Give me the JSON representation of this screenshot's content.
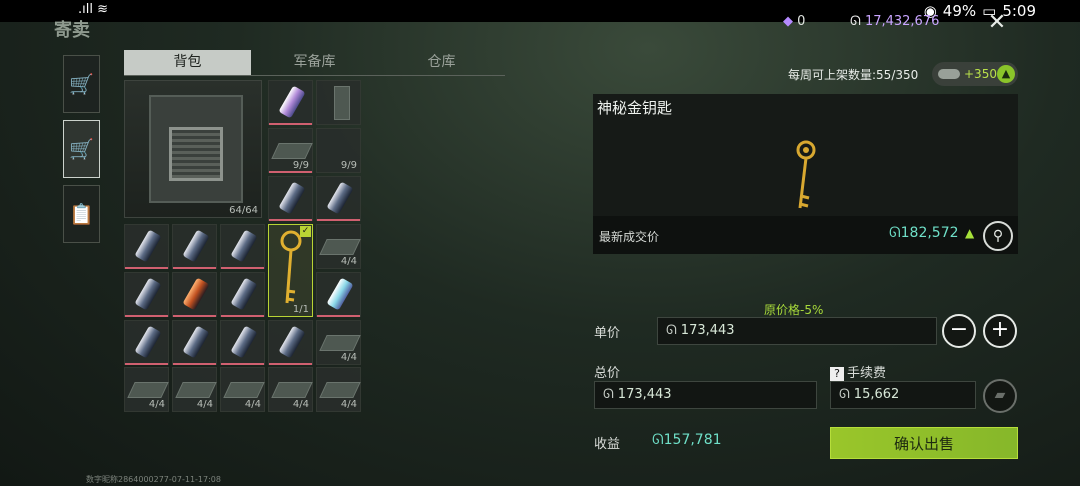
{
  "status_bar": {
    "battery": "49%",
    "time": "5:09"
  },
  "header": {
    "title": "寄卖",
    "diamonds": "0",
    "coins": "17,432,676",
    "close_icon": "close-icon"
  },
  "sidebar": [
    {
      "name": "shop-tab",
      "icon": "shopping-cart-icon"
    },
    {
      "name": "sell-tab",
      "icon": "sell-cart-icon",
      "active": true
    },
    {
      "name": "records-tab",
      "icon": "clipboard-icon"
    }
  ],
  "inventory": {
    "tabs": [
      {
        "label": "背包",
        "active": true
      },
      {
        "label": "军备库",
        "active": false
      },
      {
        "label": "仓库",
        "active": false
      }
    ],
    "big_item_qty": "64/64",
    "selected_key_qty": "1/1",
    "plate_qty": "9/9",
    "stack_qty": "4/4"
  },
  "sell_panel": {
    "weekly_label": "每周可上架数量:55/350",
    "weekly_badge": "+350",
    "item_name": "神秘金钥匙",
    "latest_label": "最新成交价",
    "latest_price": "182,572",
    "discount_text": "原价格-5%",
    "unit_label": "单价",
    "unit_price": "173,443",
    "total_label": "总价",
    "total_price": "173,443",
    "fee_label": "手续费",
    "fee_value": "15,662",
    "profit_label": "收益",
    "profit_value": "157,781",
    "confirm_label": "确认出售"
  },
  "footer": {
    "watermark": "数字昵称2864000277-07-11-17:08"
  },
  "colors": {
    "accent_green": "#9ac62a",
    "price_cyan": "#6fe0c8",
    "coin_purple": "#c9a5ff"
  }
}
